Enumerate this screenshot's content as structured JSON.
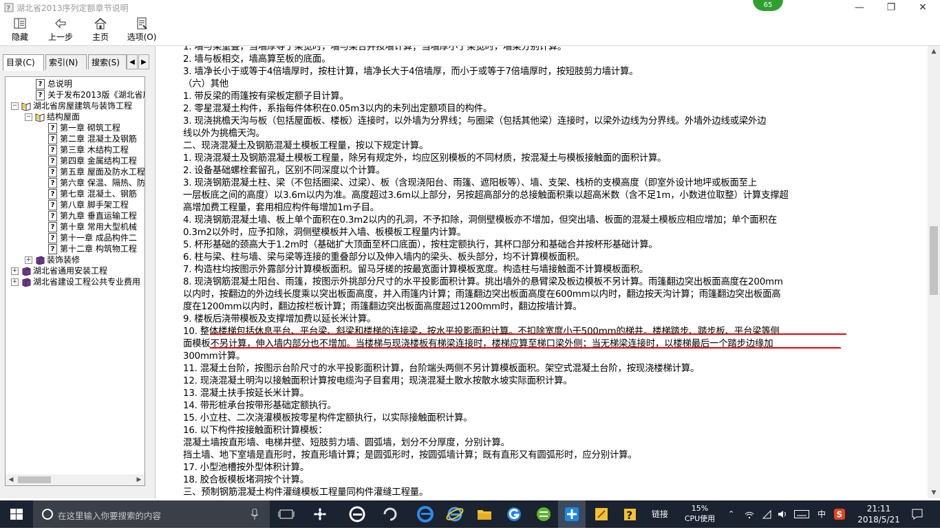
{
  "window": {
    "title": "湖北省2013序列定额章节说明",
    "badge": "65"
  },
  "toolbar": [
    {
      "label": "隐藏",
      "icon": "hide-icon"
    },
    {
      "label": "上一步",
      "icon": "back-arrow-icon"
    },
    {
      "label": "主页",
      "icon": "home-icon"
    },
    {
      "label": "选项(O)",
      "icon": "options-icon"
    }
  ],
  "tabs": [
    {
      "label": "目录(C)",
      "active": true
    },
    {
      "label": "索引(N)",
      "active": false
    },
    {
      "label": "搜索(S)",
      "active": false
    }
  ],
  "tree": [
    {
      "text": "总说明",
      "type": "doc",
      "indent": 2,
      "exp": ""
    },
    {
      "text": "关于发布2013版《湖北省房屋",
      "type": "doc",
      "indent": 2,
      "exp": ""
    },
    {
      "text": "湖北省房屋建筑与装饰工程",
      "type": "book-open",
      "indent": 0,
      "exp": "−"
    },
    {
      "text": "结构屋面",
      "type": "book-open",
      "indent": 1,
      "exp": "−"
    },
    {
      "text": "第一章 砌筑工程",
      "type": "doc",
      "indent": 3,
      "exp": ""
    },
    {
      "text": "第二章 混凝土及钢筋",
      "type": "doc",
      "indent": 3,
      "exp": ""
    },
    {
      "text": "第三章 木结构工程",
      "type": "doc",
      "indent": 3,
      "exp": ""
    },
    {
      "text": "第四章 金属结构工程",
      "type": "doc",
      "indent": 3,
      "exp": ""
    },
    {
      "text": "第五章 屋面及防水工程",
      "type": "doc",
      "indent": 3,
      "exp": ""
    },
    {
      "text": "第六章 保温、隔热、防",
      "type": "doc",
      "indent": 3,
      "exp": ""
    },
    {
      "text": "第七章 混凝土、钢筋",
      "type": "doc",
      "indent": 3,
      "exp": ""
    },
    {
      "text": "第八章 脚手架工程",
      "type": "doc",
      "indent": 3,
      "exp": ""
    },
    {
      "text": "第九章 垂直运输工程",
      "type": "doc",
      "indent": 3,
      "exp": ""
    },
    {
      "text": "第十章 常用大型机械",
      "type": "doc",
      "indent": 3,
      "exp": ""
    },
    {
      "text": "第十一章 成品构件二",
      "type": "doc",
      "indent": 3,
      "exp": ""
    },
    {
      "text": "第十二章 构筑物工程",
      "type": "doc",
      "indent": 3,
      "exp": ""
    },
    {
      "text": "装饰装修",
      "type": "book",
      "indent": 1,
      "exp": "+"
    },
    {
      "text": "湖北省通用安装工程",
      "type": "book",
      "indent": 0,
      "exp": "+"
    },
    {
      "text": "湖北省建设工程公共专业费用",
      "type": "book",
      "indent": 0,
      "exp": "+"
    }
  ],
  "content": [
    "1. 墙与梁重叠，当墙厚等于梁宽时，墙与梁合并按墙计算；当墙厚小于梁宽时，墙梁分别计算。",
    "2. 墙与板相交，墙高算至板的底面。",
    "3. 墙净长小于或等于4倍墙厚时，按柱计算，墙净长大于4倍墙厚，而小于或等于7倍墙厚时，按短肢剪力墙计算。",
    "（六）其他",
    "1. 带反梁的雨篷按有梁板定额子目计算。",
    "2. 零星混凝土构件，系指每件体积在0.05m3以内的未列出定额项目的构件。",
    "3. 现浇挑檐天沟与板（包括屋面板、楼板）连接时，以外墙为分界线；与圈梁（包括其他梁）连接时，以梁外边线为分界线。外墙外边线或梁外边",
    "线以外为挑檐天沟。",
    "二、现浇混凝土及钢筋混凝土模板工程量，按以下规定计算。",
    "1. 现浇混凝土及钢筋混凝土模板工程量，除另有规定外，均应区别模板的不同材质，按混凝土与模板接触面的面积计算。",
    "2. 设备基础螺栓套留孔，区别不同深度以个计算。",
    "3. 现浇钢筋混凝土柱、梁（不包括圈梁、过梁）、板（含现浇阳台、雨篷、遮阳板等）、墙、支架、栈桥的支模高度（即室外设计地坪或板面至上",
    "一层板底之间的高度）以3.6m以内为准。高度超过3.6m以上部分，另按超高部分的总接触面积乘以超高米数（含不足1m，小数进位取整）计算支撑超",
    "高增加费工程量，套用相应构件每增加1m子目。",
    "4. 现浇钢筋混凝土墙、板上单个面积在0.3m2以内的孔洞，不予扣除，洞侧壁模板亦不增加，但突出墙、板面的混凝土模板应相应增加；单个面积在",
    "0.3m2以外时，应予扣除，洞侧壁模板并入墙、板模板工程量内计算。",
    "5. 杯形基础的颈高大于1.2m时（基础扩大顶面至杯口底面），按柱定额执行，其杯口部分和基础合并按杯形基础计算。",
    "6. 柱与梁、柱与墙、梁与梁等连接的重叠部分以及伸入墙内的梁头、板头部分，均不计算模板面积。",
    "7. 构造柱均按图示外露部分计算模板面积。留马牙槎的按最宽面计算模板宽度。构造柱与墙接触面不计算模板面积。",
    "8. 现浇钢筋混凝土阳台、雨篷，按图示外挑部分尺寸的水平投影面积计算。挑出墙外的悬臂梁及板边模板不另计算。雨篷翻边突出板面高度在200mm",
    "以内时，按翻边的外边线长度乘以突出板面高度，并入雨篷内计算；雨篷翻边突出板面高度在600mm以内时，翻边按天沟计算；雨篷翻边突出板面高",
    "度在1200mm以内时，翻边按栏板计算；雨篷翻边突出板面高度超过1200mm时，翻边按墙计算。",
    "9. 楼板后浇带模板及支撑增加费以延长米计算。",
    "10. 整体楼梯包括休息平台、平台梁、斜梁和楼梯的连接梁，按水平投影面积计算。不扣除宽度小于500mm的梯井。楼梯踏步、踏步板、平台梁等侧",
    "面模板不另计算，伸入墙内部分也不增加。当楼梯与现浇楼板有梯梁连接时，楼梯应算至梯口梁外侧；当无梯梁连接时，以楼梯最后一个踏步边缘加",
    "300mm计算。",
    "11. 混凝土台阶，按图示台阶尺寸的水平投影面积计算，台阶端头两侧不另计算模板面积。架空式混凝土台阶，按现浇楼梯计算。",
    "12. 现浇混凝土明沟以接触面积计算按电缆沟子目套用；现浇混凝土散水按散水坡实际面积计算。",
    "13. 混凝土扶手按延长米计算。",
    "14. 带形桩承台按带形基础定额执行。",
    "15. 小立柱、二次浇灌模板按零星构件定额执行，以实际接触面积计算。",
    "16. 以下构件按接触面积计算模板：",
    "混凝土墙按直形墙、电梯井壁、短肢剪力墙、圆弧墙，划分不分厚度，分别计算。",
    "挡土墙、地下室墙是直形时，按直形墙计算；是圆弧形时，按圆弧墙计算；既有直形又有圆弧形时，应分别计算。",
    "17. 小型池槽按外型体积计算。",
    "18. 胶合板模板堵洞按个计算。",
    "三、预制钢筋混凝土构件灌缝模板工程量同构件灌缝工程量。"
  ],
  "taskbar": {
    "search_placeholder": "在这里输入你要搜索的内容",
    "link_label": "链接",
    "cpu_value": "15%",
    "cpu_label": "CPU使用",
    "ime": "中",
    "time": "21:11",
    "date": "2018/5/21"
  },
  "colors": {
    "underline": "#e00000",
    "taskbar": "#1b2230",
    "badge": "#2fa02f"
  }
}
